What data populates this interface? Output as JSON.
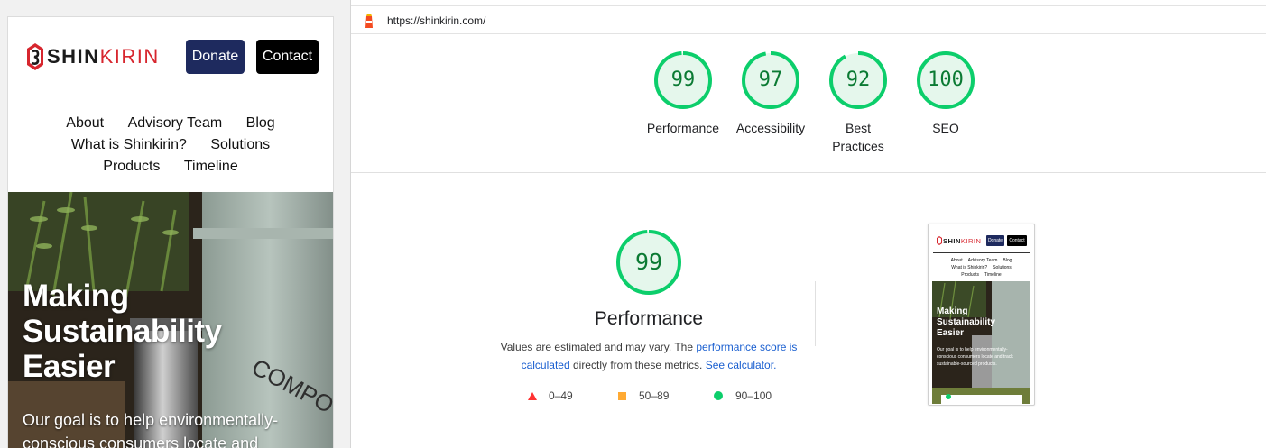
{
  "mobile": {
    "logo": {
      "part1": "SHIN",
      "part2": "KIRIN"
    },
    "buttons": {
      "donate": "Donate",
      "contact": "Contact"
    },
    "nav_rows": [
      [
        "About",
        "Advisory Team",
        "Blog"
      ],
      [
        "What is Shinkirin?",
        "Solutions"
      ],
      [
        "Products",
        "Timeline"
      ]
    ],
    "hero": {
      "title": "Making Sustainability Easier",
      "subtitle": "Our goal is to help environmentally-conscious consumers locate and",
      "canister_text": "COMPO"
    }
  },
  "report": {
    "url": "https://shinkirin.com/",
    "categories": [
      {
        "score": "99",
        "value": 99,
        "label": "Performance"
      },
      {
        "score": "97",
        "value": 97,
        "label": "Accessibility"
      },
      {
        "score": "92",
        "value": 92,
        "label": "Best Practices"
      },
      {
        "score": "100",
        "value": 100,
        "label": "SEO"
      }
    ],
    "performance": {
      "score": "99",
      "value": 99,
      "title": "Performance",
      "desc_prefix": "Values are estimated and may vary. The ",
      "desc_link1": "performance score is calculated",
      "desc_middle": " directly from these metrics. ",
      "desc_link2": "See calculator."
    },
    "legend": [
      {
        "range": "0–49",
        "color": "#ff3333",
        "shape": "triangle"
      },
      {
        "range": "50–89",
        "color": "#ffaa33",
        "shape": "square"
      },
      {
        "range": "90–100",
        "color": "#0cce6b",
        "shape": "circle"
      }
    ],
    "thumbnail": {
      "logo": {
        "part1": "SHIN",
        "part2": "KIRIN"
      },
      "buttons": {
        "donate": "Donate",
        "contact": "Contact"
      },
      "nav_rows": [
        [
          "About",
          "Advisory Team",
          "Blog"
        ],
        [
          "What is Shinkirin?",
          "Solutions"
        ],
        [
          "Products",
          "Timeline"
        ]
      ],
      "hero_title": "Making Sustainability Easier",
      "hero_subtitle": "Our goal is to help environmentally-conscious consumers locate and track sustainable-sourced products."
    }
  },
  "colors": {
    "pass": "#0cce6b",
    "pass_text": "#0b7a33",
    "pass_fill": "#e5f7ec",
    "brand_red": "#d7262e",
    "donate": "#1e2a5e"
  }
}
